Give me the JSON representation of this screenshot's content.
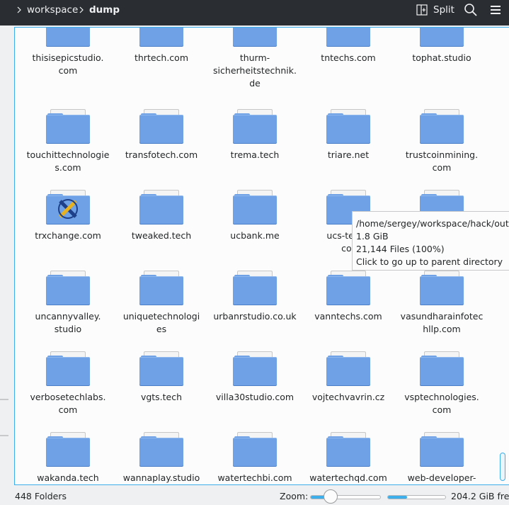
{
  "breadcrumb": {
    "workspace": "workspace",
    "current": "dump"
  },
  "toolbar": {
    "split_label": "Split",
    "search_icon": "search-icon",
    "menu_icon": "hamburger-menu-icon"
  },
  "colors": {
    "accent": "#3daee9",
    "folder": "#6ea1e5",
    "toolbar_bg": "#2a2e32"
  },
  "rows": [
    {
      "items": [
        "thisisepicstudio.\ncom",
        "thrtech.com",
        "thurm-\nsicherheitstechnik.\nde",
        "tntechs.com",
        "tophat.studio"
      ]
    },
    {
      "items": [
        "touchittechnologie\ns.com",
        "transfotech.com",
        "trema.tech",
        "triare.net",
        "trustcoinmining.\ncom"
      ]
    },
    {
      "items": [
        "trxchange.com",
        "tweaked.tech",
        "ucbank.me",
        "ucs-techn\ncor",
        ""
      ]
    },
    {
      "items": [
        "uncannyvalley.\nstudio",
        "uniquetechnologi\nes",
        "urbanrstudio.co.uk",
        "vanntechs.com",
        "vasundharainfotec\nhllp.com"
      ]
    },
    {
      "items": [
        "verbosetechlabs.\ncom",
        "vgts.tech",
        "villa30studio.com",
        "vojtechvavrin.cz",
        "vsptechnologies.\ncom"
      ]
    },
    {
      "items": [
        "wakanda.tech",
        "wannaplay.studio",
        "watertechbi.com",
        "watertechqd.com",
        "web-developer-"
      ]
    }
  ],
  "tooltip": {
    "path": "/home/sergey/workspace/hack/outpu",
    "size": "1.8 GiB",
    "files": "21,144 Files (100%)",
    "hint": "Click to go up to parent directory"
  },
  "status": {
    "folders": "448 Folders",
    "zoom_label": "Zoom:",
    "zoom_level": 0.28,
    "disk_used_fraction": 0.33,
    "free_space": "204.2 GiB free"
  }
}
